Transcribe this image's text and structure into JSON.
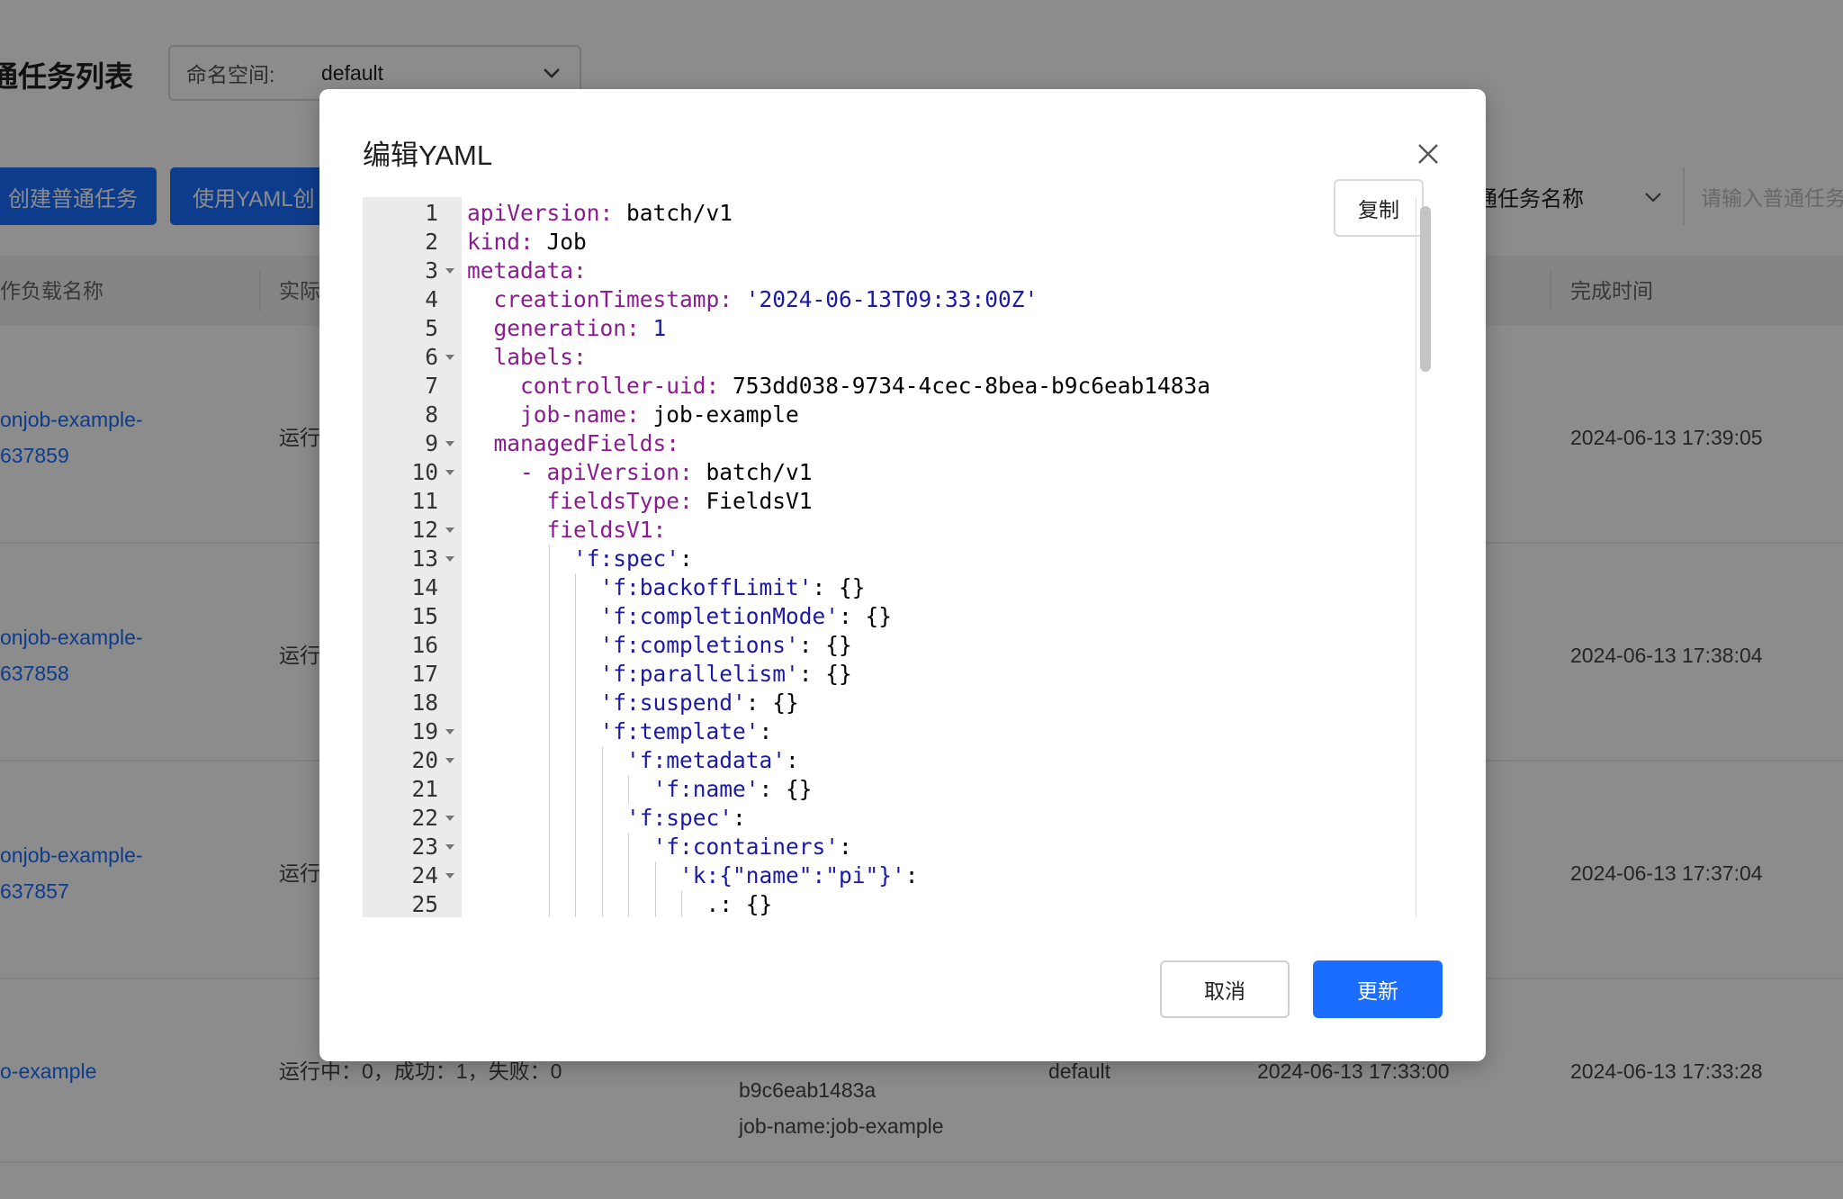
{
  "background": {
    "page_title": "通任务列表",
    "namespace": {
      "label": "命名空间:",
      "value": "default"
    },
    "buttons": {
      "create": "创建普通任务",
      "create_yaml": "使用YAML创"
    },
    "search": {
      "field": "通任务名称",
      "placeholder": "请输入普通任务"
    },
    "table": {
      "headers": [
        "作负载名称",
        "实际",
        "完成时间"
      ],
      "rows": [
        {
          "name": [
            "onjob-example-",
            "637859"
          ],
          "status": "运行",
          "finished": "2024-06-13 17:39:05"
        },
        {
          "name": [
            "onjob-example-",
            "637858"
          ],
          "status": "运行",
          "finished": "2024-06-13 17:38:04"
        },
        {
          "name": [
            "onjob-example-",
            "637857"
          ],
          "status": "运行",
          "finished": "2024-06-13 17:37:04"
        },
        {
          "name": [
            "o-example"
          ],
          "status": "运行中：0，成功：1，失败：0",
          "labels": [
            "b9c6eab1483a",
            "job-name:job-example"
          ],
          "namespace": "default",
          "created": "2024-06-13 17:33:00",
          "finished": "2024-06-13 17:33:28"
        }
      ]
    }
  },
  "modal": {
    "title": "编辑YAML",
    "copy_label": "复制",
    "cancel_label": "取消",
    "update_label": "更新",
    "lines": [
      {
        "n": "1",
        "fold": false,
        "indent": 0,
        "tokens": [
          [
            "k",
            "apiVersion:"
          ],
          [
            "p",
            " batch/v1"
          ]
        ]
      },
      {
        "n": "2",
        "fold": false,
        "indent": 0,
        "tokens": [
          [
            "k",
            "kind:"
          ],
          [
            "p",
            " Job"
          ]
        ]
      },
      {
        "n": "3",
        "fold": true,
        "indent": 0,
        "tokens": [
          [
            "k",
            "metadata:"
          ]
        ]
      },
      {
        "n": "4",
        "fold": false,
        "indent": 1,
        "tokens": [
          [
            "k",
            "creationTimestamp:"
          ],
          [
            "p",
            " "
          ],
          [
            "s",
            "'2024-06-13T09:33:00Z'"
          ]
        ]
      },
      {
        "n": "5",
        "fold": false,
        "indent": 1,
        "tokens": [
          [
            "k",
            "generation:"
          ],
          [
            "p",
            " "
          ],
          [
            "n",
            "1"
          ]
        ]
      },
      {
        "n": "6",
        "fold": true,
        "indent": 1,
        "tokens": [
          [
            "k",
            "labels:"
          ]
        ]
      },
      {
        "n": "7",
        "fold": false,
        "indent": 2,
        "tokens": [
          [
            "k",
            "controller-uid:"
          ],
          [
            "p",
            " 753dd038-9734-4cec-8bea-b9c6eab1483a"
          ]
        ]
      },
      {
        "n": "8",
        "fold": false,
        "indent": 2,
        "tokens": [
          [
            "k",
            "job-name:"
          ],
          [
            "p",
            " job-example"
          ]
        ]
      },
      {
        "n": "9",
        "fold": true,
        "indent": 1,
        "tokens": [
          [
            "k",
            "managedFields:"
          ]
        ]
      },
      {
        "n": "10",
        "fold": true,
        "indent": 2,
        "tokens": [
          [
            "k",
            "- apiVersion:"
          ],
          [
            "p",
            " batch/v1"
          ]
        ]
      },
      {
        "n": "11",
        "fold": false,
        "indent": 3,
        "tokens": [
          [
            "k",
            "fieldsType:"
          ],
          [
            "p",
            " FieldsV1"
          ]
        ]
      },
      {
        "n": "12",
        "fold": true,
        "indent": 3,
        "tokens": [
          [
            "k",
            "fieldsV1:"
          ]
        ]
      },
      {
        "n": "13",
        "fold": true,
        "indent": 4,
        "tokens": [
          [
            "s",
            "'f:spec'"
          ],
          [
            "p",
            ":"
          ]
        ]
      },
      {
        "n": "14",
        "fold": false,
        "indent": 5,
        "tokens": [
          [
            "s",
            "'f:backoffLimit'"
          ],
          [
            "p",
            ": {}"
          ]
        ]
      },
      {
        "n": "15",
        "fold": false,
        "indent": 5,
        "tokens": [
          [
            "s",
            "'f:completionMode'"
          ],
          [
            "p",
            ": {}"
          ]
        ]
      },
      {
        "n": "16",
        "fold": false,
        "indent": 5,
        "tokens": [
          [
            "s",
            "'f:completions'"
          ],
          [
            "p",
            ": {}"
          ]
        ]
      },
      {
        "n": "17",
        "fold": false,
        "indent": 5,
        "tokens": [
          [
            "s",
            "'f:parallelism'"
          ],
          [
            "p",
            ": {}"
          ]
        ]
      },
      {
        "n": "18",
        "fold": false,
        "indent": 5,
        "tokens": [
          [
            "s",
            "'f:suspend'"
          ],
          [
            "p",
            ": {}"
          ]
        ]
      },
      {
        "n": "19",
        "fold": true,
        "indent": 5,
        "tokens": [
          [
            "s",
            "'f:template'"
          ],
          [
            "p",
            ":"
          ]
        ]
      },
      {
        "n": "20",
        "fold": true,
        "indent": 6,
        "tokens": [
          [
            "s",
            "'f:metadata'"
          ],
          [
            "p",
            ":"
          ]
        ]
      },
      {
        "n": "21",
        "fold": false,
        "indent": 7,
        "tokens": [
          [
            "s",
            "'f:name'"
          ],
          [
            "p",
            ": {}"
          ]
        ]
      },
      {
        "n": "22",
        "fold": true,
        "indent": 6,
        "tokens": [
          [
            "s",
            "'f:spec'"
          ],
          [
            "p",
            ":"
          ]
        ]
      },
      {
        "n": "23",
        "fold": true,
        "indent": 7,
        "tokens": [
          [
            "s",
            "'f:containers'"
          ],
          [
            "p",
            ":"
          ]
        ]
      },
      {
        "n": "24",
        "fold": true,
        "indent": 8,
        "tokens": [
          [
            "s",
            "'k:{\"name\":\"pi\"}'"
          ],
          [
            "p",
            ":"
          ]
        ]
      },
      {
        "n": "25",
        "fold": false,
        "indent": 9,
        "tokens": [
          [
            "p",
            ".: {}"
          ]
        ]
      }
    ]
  }
}
